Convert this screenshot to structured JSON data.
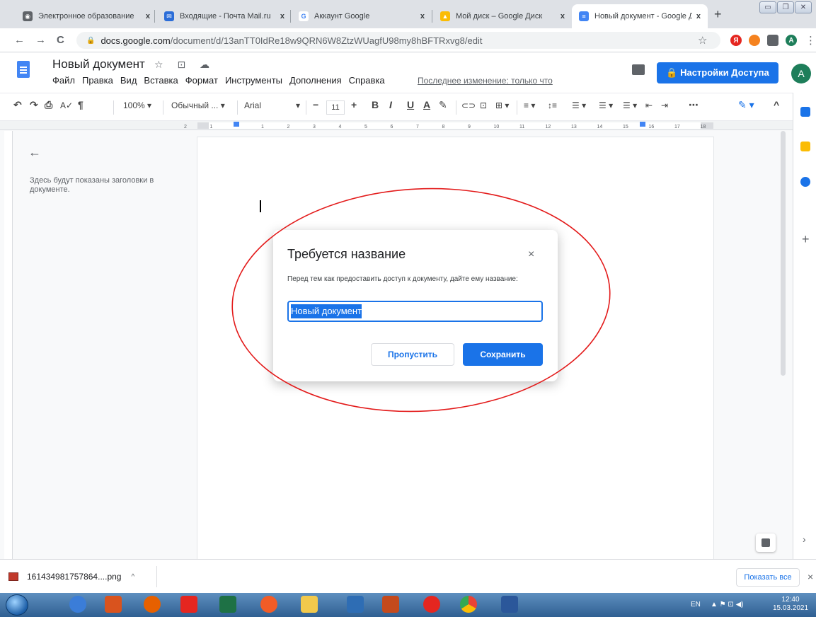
{
  "browser": {
    "tabs": [
      {
        "title": "Электронное образование",
        "favicon_color": "#5f6368",
        "glyph": "◉"
      },
      {
        "title": "Входящие - Почта Mail.ru",
        "favicon_color": "#2b6dd8",
        "glyph": "✉"
      },
      {
        "title": "Аккаунт Google",
        "favicon_color": "#ffffff",
        "glyph": "G"
      },
      {
        "title": "Мой диск – Google Диск",
        "favicon_color": "#fbbc04",
        "glyph": "▲"
      },
      {
        "title": "Новый документ - Google Д",
        "favicon_color": "#4285f4",
        "glyph": "≡"
      }
    ],
    "tab_close": "x",
    "new_tab": "+",
    "url_host": "docs.google.com",
    "url_path": "/document/d/13anTT0IdRe18w9QRN6W8ZtzWUagfU98my8hBFTRxvg8/edit",
    "back": "←",
    "forward": "→",
    "reload": "C",
    "star": "☆",
    "ext_a": "A",
    "menu_dots": "⋮"
  },
  "docs": {
    "title": "Новый документ",
    "title_icons": "☆ ⊡ ☁",
    "menu": [
      "Файл",
      "Правка",
      "Вид",
      "Вставка",
      "Формат",
      "Инструменты",
      "Дополнения",
      "Справка"
    ],
    "last_edit": "Последнее изменение: только что",
    "share_label": "🔒 Настройки Доступа",
    "avatar_letter": "A",
    "brand_color": "#4285f4",
    "accent_color": "#1a73e8"
  },
  "toolbar": {
    "undo": "↶",
    "redo": "↷",
    "print": "⎙",
    "spell": "A✓",
    "paint": "¶",
    "zoom": "100%",
    "style": "Обычный ...",
    "font": "Arial",
    "font_minus": "−",
    "font_size": "11",
    "font_plus": "+",
    "bold": "B",
    "italic": "I",
    "underline": "U",
    "text_color": "A",
    "highlight": "✎",
    "link": "⊂⊃",
    "comment": "⊡",
    "image": "⊞",
    "align": "≡",
    "line_spacing": "↕≡",
    "checklist": "☰",
    "bullets": "☰",
    "numbered": "☰",
    "indent_less": "⇤",
    "indent_more": "⇥",
    "more": "⋯",
    "edit_mode": "✎",
    "collapse": "^"
  },
  "ruler": {
    "numbers": [
      "2",
      "1",
      "1",
      "2",
      "3",
      "4",
      "5",
      "6",
      "7",
      "8",
      "9",
      "10",
      "11",
      "12",
      "13",
      "14",
      "15",
      "16",
      "17",
      "18"
    ]
  },
  "outline": {
    "back": "←",
    "text": "Здесь будут показаны заголовки в документе."
  },
  "dialog": {
    "title": "Требуется название",
    "close": "×",
    "message": "Перед тем как предоставить доступ к документу, дайте ему название:",
    "input_value": "Новый документ",
    "skip_label": "Пропустить",
    "save_label": "Сохранить"
  },
  "downloads": {
    "file_name": "161434981757864....png",
    "caret": "^",
    "show_all": "Показать все",
    "close": "×"
  },
  "taskbar": {
    "lang": "EN",
    "tray_icons": "▲ ⚑ ⊡ ◀)",
    "time": "12:40",
    "date": "15.03.2021"
  }
}
